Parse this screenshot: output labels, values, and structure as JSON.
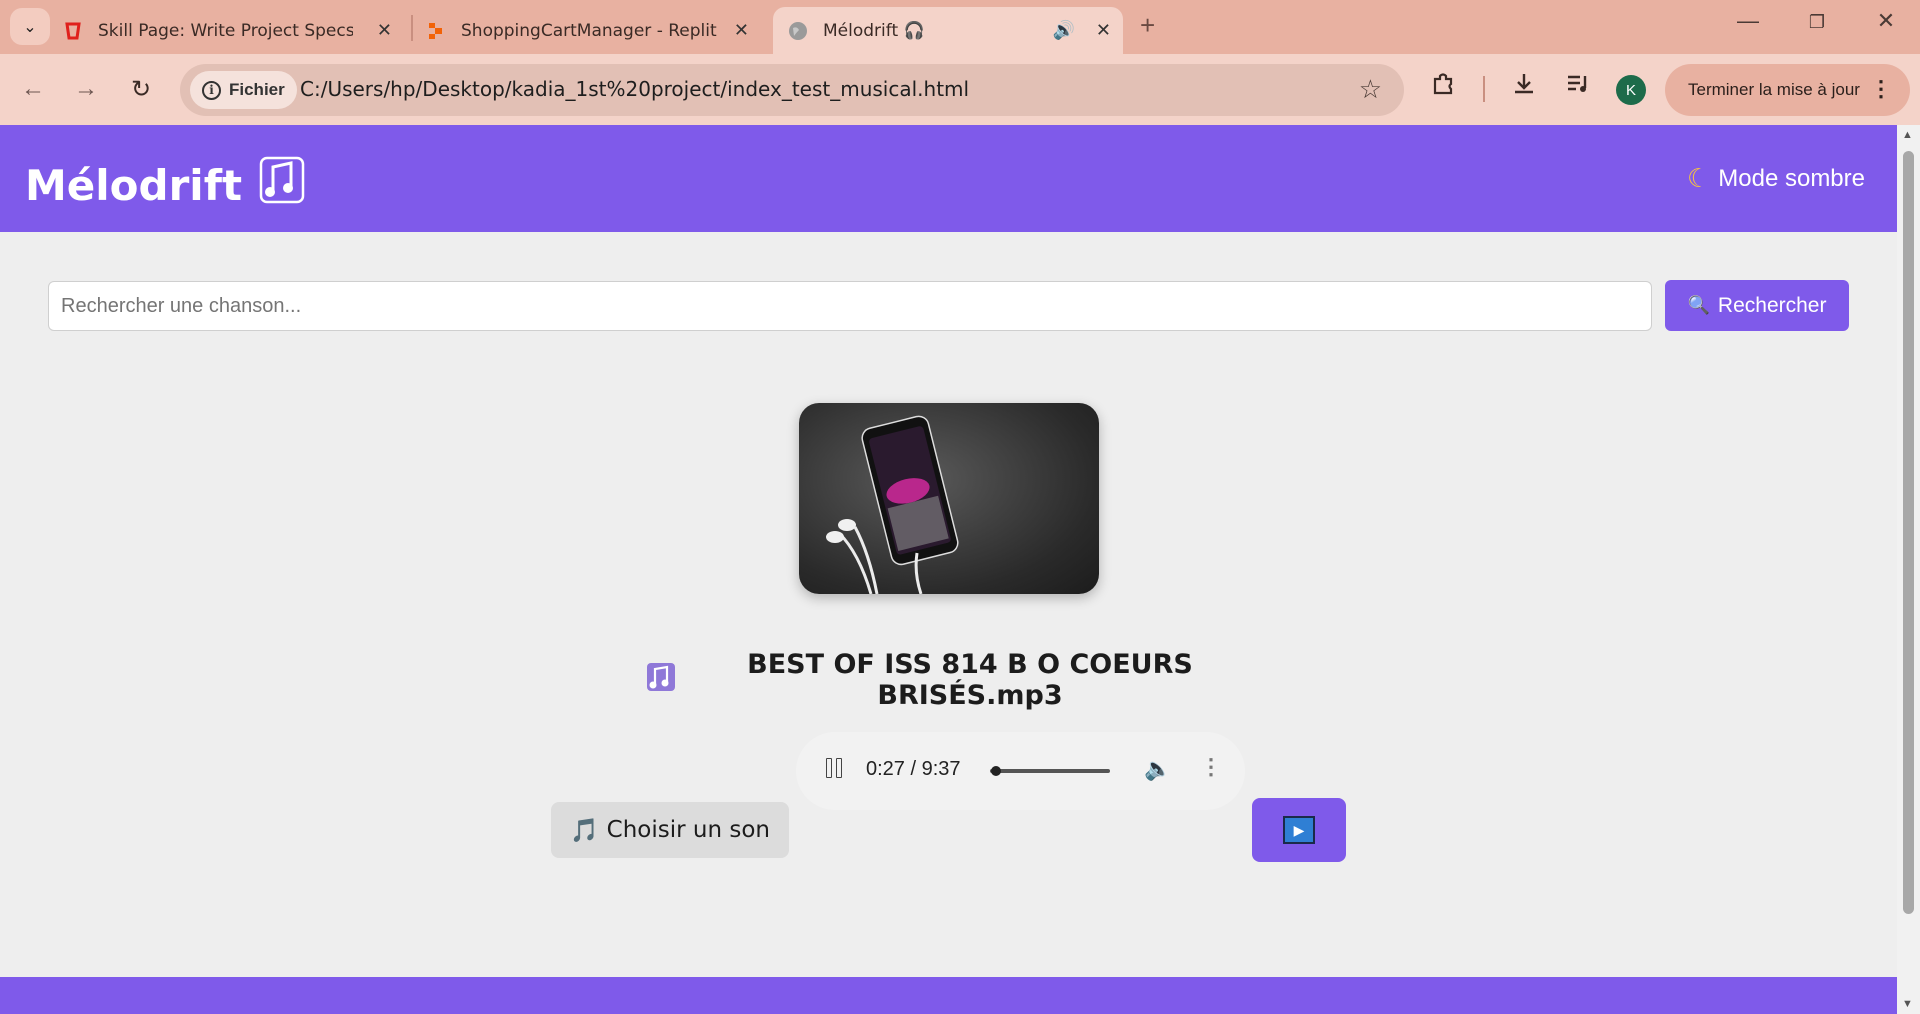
{
  "browser": {
    "tabs": [
      {
        "title": "Skill Page: Write Project Specs &",
        "icon": "skill-page-icon"
      },
      {
        "title": "ShoppingCartManager - Replit",
        "icon": "replit-icon"
      },
      {
        "title": "Mélodrift 🎧",
        "icon": "globe-icon",
        "active": true
      }
    ],
    "address": {
      "chip_label": "Fichier",
      "url": "C:/Users/hp/Desktop/kadia_1st%20project/index_test_musical.html"
    },
    "profile_initial": "K",
    "update_label": "Terminer la mise à jour"
  },
  "app": {
    "brand": "Mélodrift",
    "dark_mode_label": "Mode sombre",
    "search": {
      "placeholder": "Rechercher une chanson...",
      "button_label": "Rechercher"
    },
    "now_playing": {
      "title": "BEST OF ISS 814 B O COEURS BRISÉS.mp3"
    },
    "player": {
      "time_display": "0:27 / 9:37",
      "progress_fraction": 0.05
    },
    "choose_label": "Choisir un son"
  },
  "colors": {
    "accent": "#7f5aea",
    "tabbar": "#e8b1a1",
    "toolbar": "#f4d3c9"
  }
}
